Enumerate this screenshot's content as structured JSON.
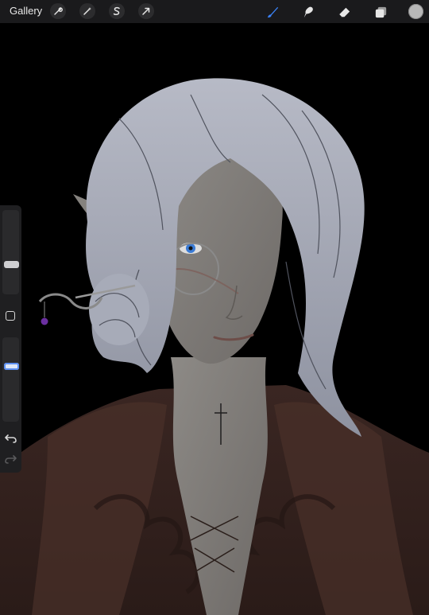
{
  "toolbar": {
    "gallery_label": "Gallery",
    "left_tools": [
      "actions-wrench-icon",
      "adjustments-wand-icon",
      "selection-s-icon",
      "transform-arrow-icon"
    ],
    "right_tools": [
      "brush-icon",
      "smudge-icon",
      "eraser-icon",
      "layers-icon"
    ],
    "active_tool": "brush-icon",
    "accent_color": "#3b82f6",
    "current_color": "#b8b8b8"
  },
  "sidebar": {
    "brush_size_level": 0.35,
    "opacity_level": 0.3,
    "buttons": [
      "modify-square-icon",
      "undo-icon",
      "redo-icon"
    ]
  },
  "canvas": {
    "background_color": "#000000",
    "subject": "elf-portrait-illustration"
  }
}
